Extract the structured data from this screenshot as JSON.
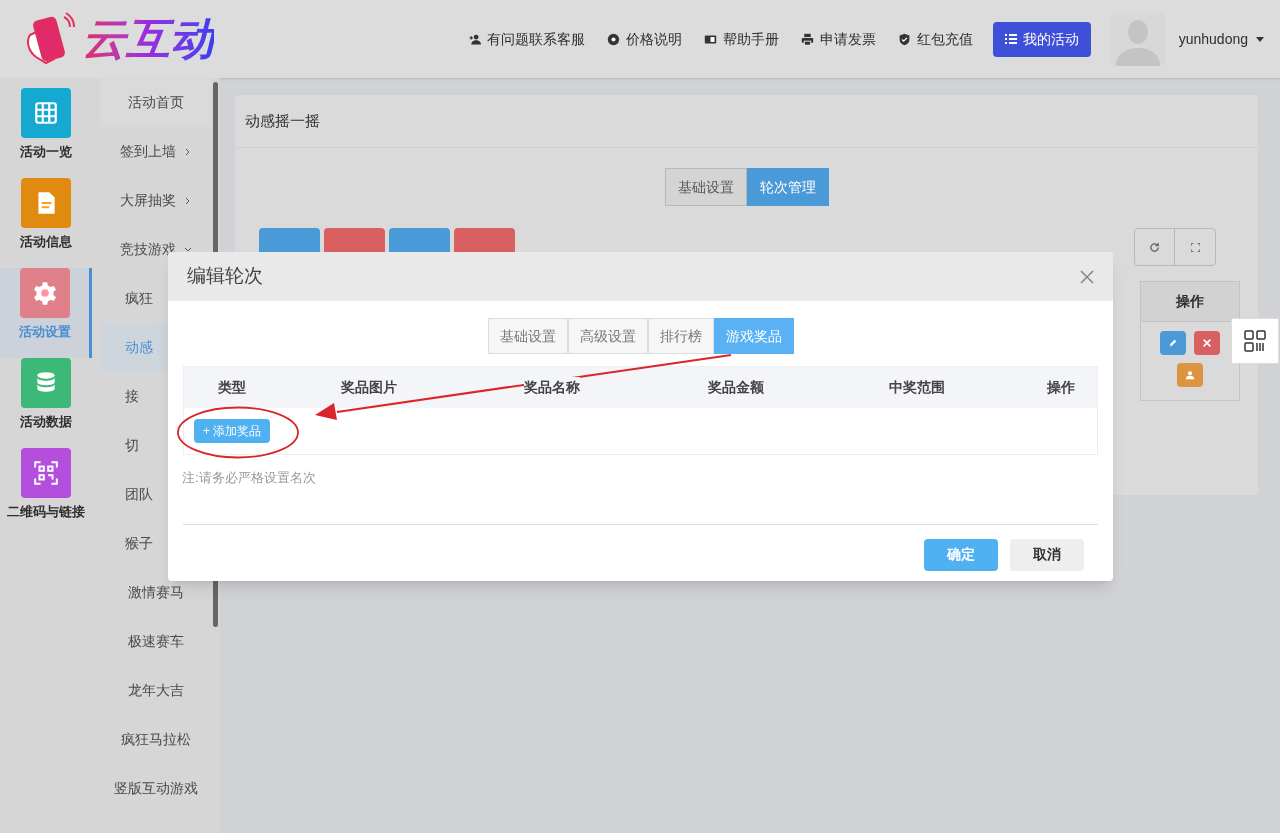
{
  "header": {
    "logo_text": "云互动",
    "links": [
      {
        "kind": "user",
        "label": "有问题联系客服"
      },
      {
        "kind": "gear",
        "label": "价格说明"
      },
      {
        "kind": "book",
        "label": "帮助手册"
      },
      {
        "kind": "print",
        "label": "申请发票"
      },
      {
        "kind": "shield",
        "label": "红包充值"
      }
    ],
    "my_activity_button": "我的活动",
    "username": "yunhudong"
  },
  "sidebar": {
    "items": [
      {
        "kind": "grid",
        "label": "活动一览",
        "selected": false,
        "color": "#15a8d0"
      },
      {
        "kind": "doc",
        "label": "活动信息",
        "selected": false,
        "color": "#e08a10"
      },
      {
        "kind": "gear",
        "label": "活动设置",
        "selected": true,
        "color": "#e0808a"
      },
      {
        "kind": "db",
        "label": "活动数据",
        "selected": false,
        "color": "#3cb878"
      },
      {
        "kind": "qr",
        "label": "二维码与链接",
        "selected": false,
        "color": "#b44fdd"
      }
    ]
  },
  "submenu": {
    "items": [
      {
        "kind": "item",
        "label": "活动首页",
        "selected": false
      },
      {
        "kind": "group",
        "label": "签到上墙",
        "selected": false,
        "expanded": false
      },
      {
        "kind": "group",
        "label": "大屏抽奖",
        "selected": false,
        "expanded": false
      },
      {
        "kind": "group",
        "label": "竞技游戏",
        "selected": false,
        "expanded": true
      },
      {
        "kind": "partial",
        "label": "疯狂",
        "selected": false
      },
      {
        "kind": "partial",
        "label": "动感",
        "selected": true
      },
      {
        "kind": "partial",
        "label": "接",
        "selected": false
      },
      {
        "kind": "partial",
        "label": "切",
        "selected": false
      },
      {
        "kind": "partial",
        "label": "团队",
        "selected": false
      },
      {
        "kind": "partial",
        "label": "猴子",
        "selected": false
      },
      {
        "kind": "item",
        "label": "激情赛马",
        "selected": false
      },
      {
        "kind": "item",
        "label": "极速赛车",
        "selected": false
      },
      {
        "kind": "item",
        "label": "龙年大吉",
        "selected": false
      },
      {
        "kind": "item",
        "label": "疯狂马拉松",
        "selected": false
      },
      {
        "kind": "item",
        "label": "竖版互动游戏",
        "selected": false
      }
    ]
  },
  "page": {
    "title": "动感摇一摇",
    "tabs": [
      {
        "label": "基础设置",
        "selected": false
      },
      {
        "label": "轮次管理",
        "selected": true
      }
    ],
    "toolbar_buttons": [
      {
        "color": "#4a9ad8"
      },
      {
        "color": "#d86060"
      },
      {
        "color": "#4a9ad8"
      },
      {
        "color": "#d86060"
      }
    ],
    "table_header": "操作",
    "row_actions": [
      {
        "kind": "edit"
      },
      {
        "kind": "delete"
      },
      {
        "kind": "user"
      }
    ]
  },
  "modal": {
    "title": "编辑轮次",
    "tabs": [
      {
        "label": "基础设置",
        "selected": false
      },
      {
        "label": "高级设置",
        "selected": false
      },
      {
        "label": "排行榜",
        "selected": false
      },
      {
        "label": "游戏奖品",
        "selected": true
      }
    ],
    "columns": [
      "类型",
      "奖品图片",
      "奖品名称",
      "奖品金额",
      "中奖范围",
      "操作"
    ],
    "add_button": "+ 添加奖品",
    "note": "注:请务必严格设置名次",
    "confirm": "确定",
    "cancel": "取消"
  }
}
